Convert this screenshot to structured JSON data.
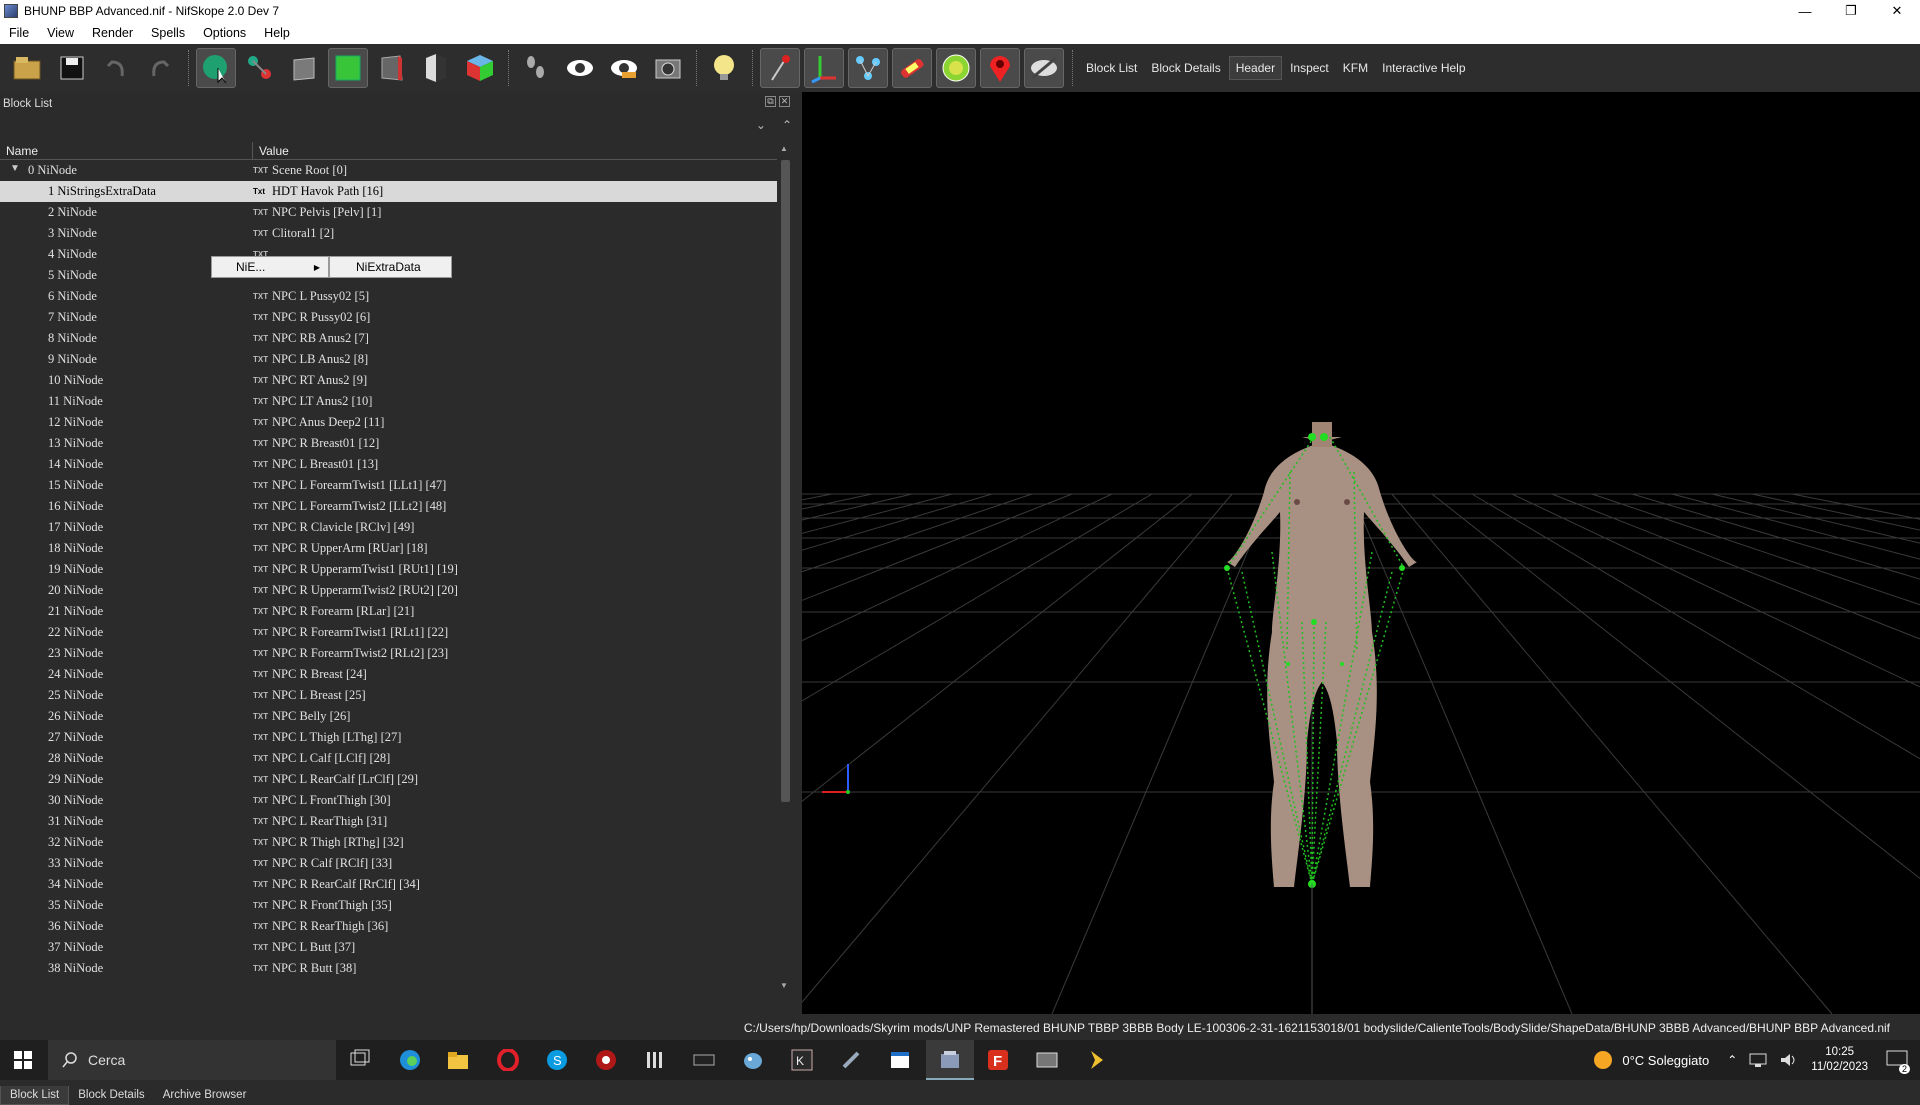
{
  "window": {
    "title": "BHUNP BBP Advanced.nif - NifSkope 2.0 Dev 7",
    "controls": [
      "—",
      "❐",
      "✕"
    ]
  },
  "menu": [
    "File",
    "View",
    "Render",
    "Spells",
    "Options",
    "Help"
  ],
  "toolbar": {
    "text_buttons": [
      "Block List",
      "Block Details",
      "Header",
      "Inspect",
      "KFM",
      "Interactive Help"
    ],
    "icons": [
      "open-icon",
      "save-icon",
      "undo-icon",
      "redo-icon",
      "select-object-icon",
      "select-vertex-icon",
      "view-perspective-icon",
      "view-front-icon",
      "view-side-icon",
      "view-back-icon",
      "view-iso-icon",
      "walk-icon",
      "eye-icon",
      "eye-alt-icon",
      "screenshot-icon",
      "light-icon",
      "vertex-icon",
      "axes-icon",
      "nodes-icon",
      "constraints-icon",
      "havok-icon",
      "markers-icon",
      "hidden-icon"
    ]
  },
  "block_list": {
    "dock_title": "Block List",
    "columns": [
      "Name",
      "Value"
    ],
    "rows": [
      {
        "name": "0 NiNode",
        "value": "Scene Root [0]",
        "ico": "TXT",
        "indent": 0,
        "expander": "▼"
      },
      {
        "name": "1 NiStringsExtraData",
        "value": "HDT Havok Path [16]",
        "ico": "Txt",
        "indent": 1,
        "selected": true
      },
      {
        "name": "2 NiNode",
        "value": "NPC Pelvis [Pelv] [1]",
        "ico": "TXT",
        "indent": 1
      },
      {
        "name": "3 NiNode",
        "value": "Clitoral1 [2]",
        "ico": "TXT",
        "indent": 1
      },
      {
        "name": "4 NiNode",
        "value": "",
        "ico": "TXT",
        "indent": 1
      },
      {
        "name": "5 NiNode",
        "value": "",
        "ico": "TXT",
        "indent": 1
      },
      {
        "name": "6 NiNode",
        "value": "NPC L Pussy02 [5]",
        "ico": "TXT",
        "indent": 1
      },
      {
        "name": "7 NiNode",
        "value": "NPC R Pussy02 [6]",
        "ico": "TXT",
        "indent": 1
      },
      {
        "name": "8 NiNode",
        "value": "NPC RB Anus2 [7]",
        "ico": "TXT",
        "indent": 1
      },
      {
        "name": "9 NiNode",
        "value": "NPC LB Anus2 [8]",
        "ico": "TXT",
        "indent": 1
      },
      {
        "name": "10 NiNode",
        "value": "NPC RT Anus2 [9]",
        "ico": "TXT",
        "indent": 1
      },
      {
        "name": "11 NiNode",
        "value": "NPC LT Anus2 [10]",
        "ico": "TXT",
        "indent": 1
      },
      {
        "name": "12 NiNode",
        "value": "NPC Anus Deep2 [11]",
        "ico": "TXT",
        "indent": 1
      },
      {
        "name": "13 NiNode",
        "value": "NPC R Breast01 [12]",
        "ico": "TXT",
        "indent": 1
      },
      {
        "name": "14 NiNode",
        "value": "NPC L Breast01 [13]",
        "ico": "TXT",
        "indent": 1
      },
      {
        "name": "15 NiNode",
        "value": "NPC L ForearmTwist1 [LLt1] [47]",
        "ico": "TXT",
        "indent": 1
      },
      {
        "name": "16 NiNode",
        "value": "NPC L ForearmTwist2 [LLt2] [48]",
        "ico": "TXT",
        "indent": 1
      },
      {
        "name": "17 NiNode",
        "value": "NPC R Clavicle [RClv] [49]",
        "ico": "TXT",
        "indent": 1
      },
      {
        "name": "18 NiNode",
        "value": "NPC R UpperArm [RUar] [18]",
        "ico": "TXT",
        "indent": 1
      },
      {
        "name": "19 NiNode",
        "value": "NPC R UpperarmTwist1 [RUt1] [19]",
        "ico": "TXT",
        "indent": 1
      },
      {
        "name": "20 NiNode",
        "value": "NPC R UpperarmTwist2 [RUt2] [20]",
        "ico": "TXT",
        "indent": 1
      },
      {
        "name": "21 NiNode",
        "value": "NPC R Forearm [RLar] [21]",
        "ico": "TXT",
        "indent": 1
      },
      {
        "name": "22 NiNode",
        "value": "NPC R ForearmTwist1 [RLt1] [22]",
        "ico": "TXT",
        "indent": 1
      },
      {
        "name": "23 NiNode",
        "value": "NPC R ForearmTwist2 [RLt2] [23]",
        "ico": "TXT",
        "indent": 1
      },
      {
        "name": "24 NiNode",
        "value": "NPC R Breast [24]",
        "ico": "TXT",
        "indent": 1
      },
      {
        "name": "25 NiNode",
        "value": "NPC L Breast [25]",
        "ico": "TXT",
        "indent": 1
      },
      {
        "name": "26 NiNode",
        "value": "NPC Belly [26]",
        "ico": "TXT",
        "indent": 1
      },
      {
        "name": "27 NiNode",
        "value": "NPC L Thigh [LThg] [27]",
        "ico": "TXT",
        "indent": 1
      },
      {
        "name": "28 NiNode",
        "value": "NPC L Calf [LClf] [28]",
        "ico": "TXT",
        "indent": 1
      },
      {
        "name": "29 NiNode",
        "value": "NPC L RearCalf [LrClf] [29]",
        "ico": "TXT",
        "indent": 1
      },
      {
        "name": "30 NiNode",
        "value": "NPC L FrontThigh [30]",
        "ico": "TXT",
        "indent": 1
      },
      {
        "name": "31 NiNode",
        "value": "NPC L RearThigh [31]",
        "ico": "TXT",
        "indent": 1
      },
      {
        "name": "32 NiNode",
        "value": "NPC R Thigh [RThg] [32]",
        "ico": "TXT",
        "indent": 1
      },
      {
        "name": "33 NiNode",
        "value": "NPC R Calf [RClf] [33]",
        "ico": "TXT",
        "indent": 1
      },
      {
        "name": "34 NiNode",
        "value": "NPC R RearCalf [RrClf] [34]",
        "ico": "TXT",
        "indent": 1
      },
      {
        "name": "35 NiNode",
        "value": "NPC R FrontThigh [35]",
        "ico": "TXT",
        "indent": 1
      },
      {
        "name": "36 NiNode",
        "value": "NPC R RearThigh [36]",
        "ico": "TXT",
        "indent": 1
      },
      {
        "name": "37 NiNode",
        "value": "NPC L Butt [37]",
        "ico": "TXT",
        "indent": 1
      },
      {
        "name": "38 NiNode",
        "value": "NPC R Butt [38]",
        "ico": "TXT",
        "indent": 1
      }
    ]
  },
  "context_menu": {
    "item": "NiE...",
    "submenu_item": "NiExtraData"
  },
  "bottom_tabs": [
    "Block List",
    "Block Details",
    "Archive Browser"
  ],
  "status_path": "C:/Users/hp/Downloads/Skyrim mods/UNP Remastered BHUNP TBBP 3BBB Body LE-100306-2-31-1621153018/01 bodyslide/CalienteTools/BodySlide/ShapeData/BHUNP 3BBB Advanced/BHUNP BBP Advanced.nif",
  "taskbar": {
    "search_label": "Cerca",
    "weather": "0°C Soleggiato",
    "time": "10:25",
    "date": "11/02/2023",
    "notification_count": "2"
  }
}
